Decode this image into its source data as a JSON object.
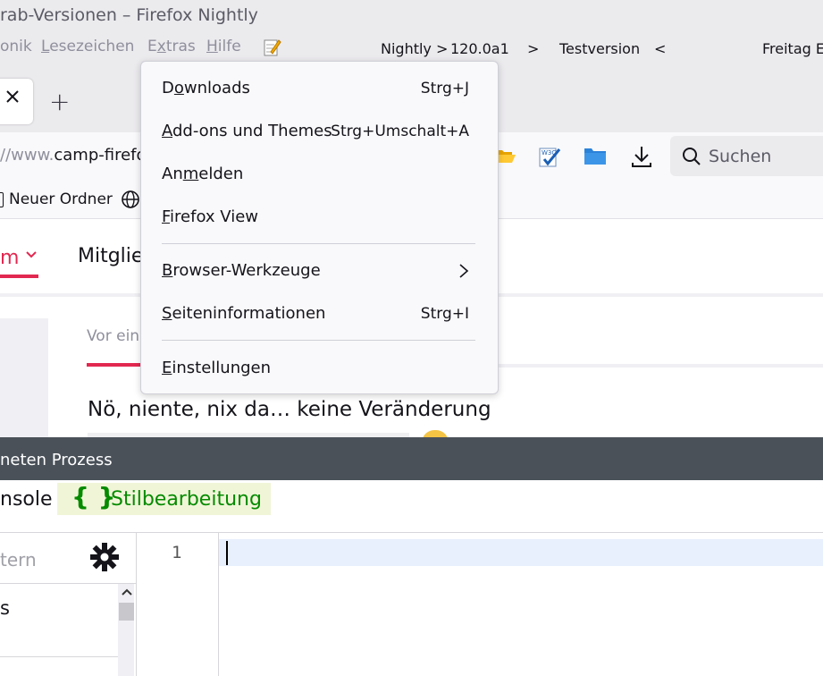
{
  "window": {
    "title": "rab-Versionen – Firefox Nightly"
  },
  "menubar": {
    "items": [
      {
        "label": "onik",
        "ul": ""
      },
      {
        "label_pre": "",
        "ul": "L",
        "label_post": "esezeichen"
      },
      {
        "label_pre": "E",
        "ul": "x",
        "label_post": "tras"
      },
      {
        "label_pre": "",
        "ul": "H",
        "label_post": "ilfe"
      }
    ],
    "version_info": [
      "Nightly",
      ">",
      "120.0a1",
      ">",
      "Testversion",
      "<",
      "Freitag E"
    ]
  },
  "tabs": {
    "new_tab_symbol": "+"
  },
  "navbar": {
    "url_prefix": "//www.",
    "url_host": "camp-firefo",
    "search_placeholder": "Suchen"
  },
  "bookmarks": {
    "folder_label": "Neuer Ordner"
  },
  "page": {
    "nav_active": "m",
    "nav_second": "Mitglie",
    "meta_text": "Vor ein",
    "post_text": "Nö, niente, nix da… keine Veränderung"
  },
  "devtools": {
    "toolbar_title": "neten Prozess",
    "tab_console": "nsole",
    "tab_style_icon": "{ }",
    "tab_style": "Stilbearbeitung",
    "filter_placeholder": "tern",
    "list_item": "s",
    "line_number": "1"
  },
  "extras_menu": {
    "items": [
      {
        "pre": "D",
        "ul": "o",
        "post": "wnloads",
        "shortcut": "Strg+J"
      },
      {
        "pre": "",
        "ul": "A",
        "post": "dd-ons und Themes",
        "shortcut": "Strg+Umschalt+A"
      },
      {
        "pre": "An",
        "ul": "m",
        "post": "elden",
        "shortcut": ""
      },
      {
        "pre": "",
        "ul": "F",
        "post": "irefox View",
        "shortcut": ""
      },
      {
        "pre": "",
        "ul": "B",
        "post": "rowser-Werkzeuge",
        "shortcut": ""
      },
      {
        "pre": "",
        "ul": "S",
        "post": "eiteninformationen",
        "shortcut": "Strg+I"
      },
      {
        "pre": "",
        "ul": "E",
        "post": "instellungen",
        "shortcut": ""
      }
    ]
  },
  "icons": {
    "tab_close": "close-icon",
    "new_tab": "plus-icon",
    "submenu": "chevron-right-icon",
    "folder_open": "folder-open-icon",
    "w3c": "w3c-validator-icon",
    "folder": "folder-icon",
    "download": "download-icon",
    "search": "search-icon",
    "globe": "globe-icon",
    "settings": "gear-icon"
  },
  "colors": {
    "accent_red": "#e22850",
    "style_green": "#058b00",
    "devbar": "#4a5159"
  }
}
